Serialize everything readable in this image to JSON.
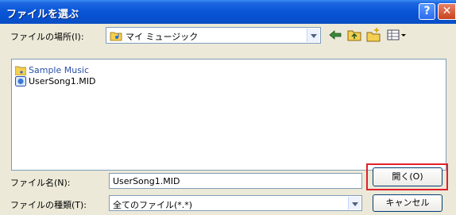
{
  "window": {
    "title": "ファイルを選ぶ",
    "help_glyph": "?",
    "close_glyph": "✕"
  },
  "location": {
    "label": "ファイルの場所(I):",
    "value": "マイ ミュージック"
  },
  "toolbar": {
    "icons": [
      "back-arrow-icon",
      "up-folder-icon",
      "new-folder-icon",
      "view-menu-icon"
    ]
  },
  "files": [
    {
      "name": "Sample Music",
      "icon": "folder-icon"
    },
    {
      "name": "UserSong1.MID",
      "icon": "midi-file-icon"
    }
  ],
  "filename": {
    "label": "ファイル名(N):",
    "value": "UserSong1.MID"
  },
  "filetype": {
    "label": "ファイルの種類(T):",
    "value": "全てのファイル(*.*)"
  },
  "buttons": {
    "open": "開く(O)",
    "cancel": "キャンセル"
  },
  "colors": {
    "titlebar": "#0a56d8",
    "highlight": "#e0202a",
    "dialog_bg": "#ece9d8"
  }
}
